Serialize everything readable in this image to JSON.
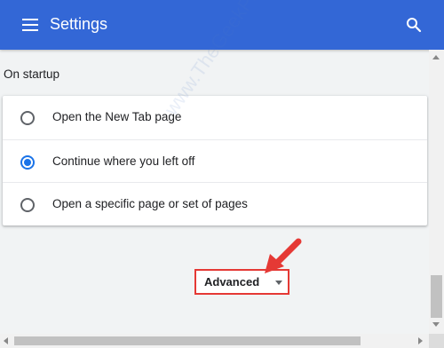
{
  "header": {
    "title": "Settings",
    "menu_icon": "hamburger-menu-icon",
    "search_icon": "search-icon",
    "background": "#3367d6"
  },
  "startup": {
    "section_title": "On startup",
    "options": [
      {
        "label": "Open the New Tab page",
        "selected": false
      },
      {
        "label": "Continue where you left off",
        "selected": true
      },
      {
        "label": "Open a specific page or set of pages",
        "selected": false
      }
    ],
    "accent": "#1a73e8"
  },
  "advanced": {
    "label": "Advanced",
    "caret_icon": "caret-down-icon",
    "highlight_color": "#e53935"
  },
  "watermark": "www.TheGeekPage.com"
}
